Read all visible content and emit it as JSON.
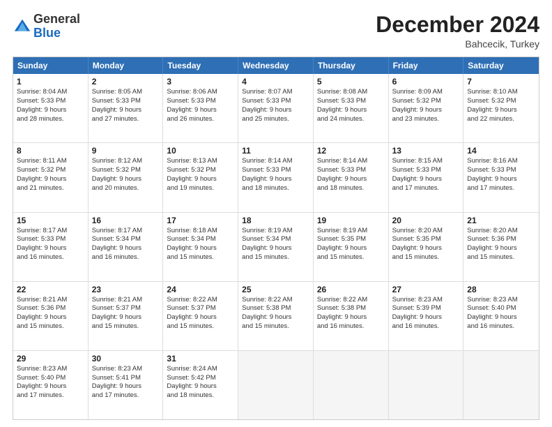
{
  "logo": {
    "general": "General",
    "blue": "Blue"
  },
  "title": "December 2024",
  "location": "Bahcecik, Turkey",
  "days_of_week": [
    "Sunday",
    "Monday",
    "Tuesday",
    "Wednesday",
    "Thursday",
    "Friday",
    "Saturday"
  ],
  "rows": [
    [
      {
        "day": "1",
        "lines": [
          "Sunrise: 8:04 AM",
          "Sunset: 5:33 PM",
          "Daylight: 9 hours",
          "and 28 minutes."
        ]
      },
      {
        "day": "2",
        "lines": [
          "Sunrise: 8:05 AM",
          "Sunset: 5:33 PM",
          "Daylight: 9 hours",
          "and 27 minutes."
        ]
      },
      {
        "day": "3",
        "lines": [
          "Sunrise: 8:06 AM",
          "Sunset: 5:33 PM",
          "Daylight: 9 hours",
          "and 26 minutes."
        ]
      },
      {
        "day": "4",
        "lines": [
          "Sunrise: 8:07 AM",
          "Sunset: 5:33 PM",
          "Daylight: 9 hours",
          "and 25 minutes."
        ]
      },
      {
        "day": "5",
        "lines": [
          "Sunrise: 8:08 AM",
          "Sunset: 5:33 PM",
          "Daylight: 9 hours",
          "and 24 minutes."
        ]
      },
      {
        "day": "6",
        "lines": [
          "Sunrise: 8:09 AM",
          "Sunset: 5:32 PM",
          "Daylight: 9 hours",
          "and 23 minutes."
        ]
      },
      {
        "day": "7",
        "lines": [
          "Sunrise: 8:10 AM",
          "Sunset: 5:32 PM",
          "Daylight: 9 hours",
          "and 22 minutes."
        ]
      }
    ],
    [
      {
        "day": "8",
        "lines": [
          "Sunrise: 8:11 AM",
          "Sunset: 5:32 PM",
          "Daylight: 9 hours",
          "and 21 minutes."
        ]
      },
      {
        "day": "9",
        "lines": [
          "Sunrise: 8:12 AM",
          "Sunset: 5:32 PM",
          "Daylight: 9 hours",
          "and 20 minutes."
        ]
      },
      {
        "day": "10",
        "lines": [
          "Sunrise: 8:13 AM",
          "Sunset: 5:32 PM",
          "Daylight: 9 hours",
          "and 19 minutes."
        ]
      },
      {
        "day": "11",
        "lines": [
          "Sunrise: 8:14 AM",
          "Sunset: 5:33 PM",
          "Daylight: 9 hours",
          "and 18 minutes."
        ]
      },
      {
        "day": "12",
        "lines": [
          "Sunrise: 8:14 AM",
          "Sunset: 5:33 PM",
          "Daylight: 9 hours",
          "and 18 minutes."
        ]
      },
      {
        "day": "13",
        "lines": [
          "Sunrise: 8:15 AM",
          "Sunset: 5:33 PM",
          "Daylight: 9 hours",
          "and 17 minutes."
        ]
      },
      {
        "day": "14",
        "lines": [
          "Sunrise: 8:16 AM",
          "Sunset: 5:33 PM",
          "Daylight: 9 hours",
          "and 17 minutes."
        ]
      }
    ],
    [
      {
        "day": "15",
        "lines": [
          "Sunrise: 8:17 AM",
          "Sunset: 5:33 PM",
          "Daylight: 9 hours",
          "and 16 minutes."
        ]
      },
      {
        "day": "16",
        "lines": [
          "Sunrise: 8:17 AM",
          "Sunset: 5:34 PM",
          "Daylight: 9 hours",
          "and 16 minutes."
        ]
      },
      {
        "day": "17",
        "lines": [
          "Sunrise: 8:18 AM",
          "Sunset: 5:34 PM",
          "Daylight: 9 hours",
          "and 15 minutes."
        ]
      },
      {
        "day": "18",
        "lines": [
          "Sunrise: 8:19 AM",
          "Sunset: 5:34 PM",
          "Daylight: 9 hours",
          "and 15 minutes."
        ]
      },
      {
        "day": "19",
        "lines": [
          "Sunrise: 8:19 AM",
          "Sunset: 5:35 PM",
          "Daylight: 9 hours",
          "and 15 minutes."
        ]
      },
      {
        "day": "20",
        "lines": [
          "Sunrise: 8:20 AM",
          "Sunset: 5:35 PM",
          "Daylight: 9 hours",
          "and 15 minutes."
        ]
      },
      {
        "day": "21",
        "lines": [
          "Sunrise: 8:20 AM",
          "Sunset: 5:36 PM",
          "Daylight: 9 hours",
          "and 15 minutes."
        ]
      }
    ],
    [
      {
        "day": "22",
        "lines": [
          "Sunrise: 8:21 AM",
          "Sunset: 5:36 PM",
          "Daylight: 9 hours",
          "and 15 minutes."
        ]
      },
      {
        "day": "23",
        "lines": [
          "Sunrise: 8:21 AM",
          "Sunset: 5:37 PM",
          "Daylight: 9 hours",
          "and 15 minutes."
        ]
      },
      {
        "day": "24",
        "lines": [
          "Sunrise: 8:22 AM",
          "Sunset: 5:37 PM",
          "Daylight: 9 hours",
          "and 15 minutes."
        ]
      },
      {
        "day": "25",
        "lines": [
          "Sunrise: 8:22 AM",
          "Sunset: 5:38 PM",
          "Daylight: 9 hours",
          "and 15 minutes."
        ]
      },
      {
        "day": "26",
        "lines": [
          "Sunrise: 8:22 AM",
          "Sunset: 5:38 PM",
          "Daylight: 9 hours",
          "and 16 minutes."
        ]
      },
      {
        "day": "27",
        "lines": [
          "Sunrise: 8:23 AM",
          "Sunset: 5:39 PM",
          "Daylight: 9 hours",
          "and 16 minutes."
        ]
      },
      {
        "day": "28",
        "lines": [
          "Sunrise: 8:23 AM",
          "Sunset: 5:40 PM",
          "Daylight: 9 hours",
          "and 16 minutes."
        ]
      }
    ],
    [
      {
        "day": "29",
        "lines": [
          "Sunrise: 8:23 AM",
          "Sunset: 5:40 PM",
          "Daylight: 9 hours",
          "and 17 minutes."
        ]
      },
      {
        "day": "30",
        "lines": [
          "Sunrise: 8:23 AM",
          "Sunset: 5:41 PM",
          "Daylight: 9 hours",
          "and 17 minutes."
        ]
      },
      {
        "day": "31",
        "lines": [
          "Sunrise: 8:24 AM",
          "Sunset: 5:42 PM",
          "Daylight: 9 hours",
          "and 18 minutes."
        ]
      },
      null,
      null,
      null,
      null
    ]
  ]
}
